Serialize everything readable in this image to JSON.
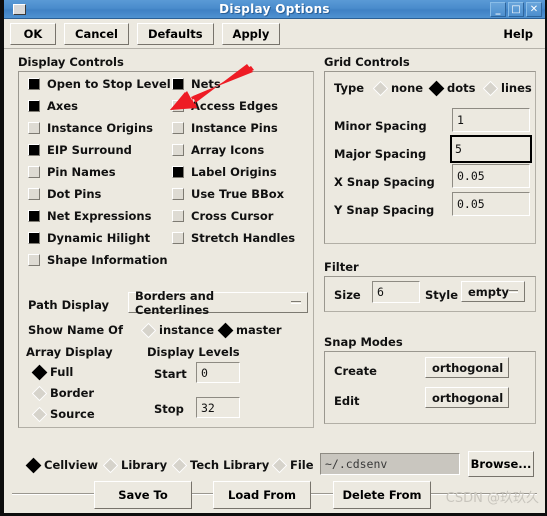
{
  "window": {
    "title": "Display Options",
    "icon": "window-menu-icon",
    "buttons": [
      {
        "name": "minimize",
        "glyph": "_"
      },
      {
        "name": "maximize",
        "glyph": "□"
      },
      {
        "name": "close",
        "glyph": "✕"
      }
    ]
  },
  "toolbar": {
    "ok": "OK",
    "cancel": "Cancel",
    "defaults": "Defaults",
    "apply": "Apply",
    "help": "Help"
  },
  "display_controls": {
    "title": "Display Controls",
    "left_column": [
      {
        "label": "Open to Stop Level",
        "checked": true
      },
      {
        "label": "Axes",
        "checked": true
      },
      {
        "label": "Instance Origins",
        "checked": false
      },
      {
        "label": "EIP Surround",
        "checked": true
      },
      {
        "label": "Pin Names",
        "checked": false
      },
      {
        "label": "Dot Pins",
        "checked": false
      },
      {
        "label": "Net Expressions",
        "checked": true
      },
      {
        "label": "Dynamic Hilight",
        "checked": true
      },
      {
        "label": "Shape Information",
        "checked": false
      }
    ],
    "right_column": [
      {
        "label": "Nets",
        "checked": true
      },
      {
        "label": "Access Edges",
        "checked": false
      },
      {
        "label": "Instance Pins",
        "checked": false
      },
      {
        "label": "Array Icons",
        "checked": false
      },
      {
        "label": "Label Origins",
        "checked": true
      },
      {
        "label": "Use True BBox",
        "checked": false
      },
      {
        "label": "Cross Cursor",
        "checked": false
      },
      {
        "label": "Stretch Handles",
        "checked": false
      }
    ],
    "path_display": {
      "label": "Path Display",
      "value": "Borders and Centerlines"
    },
    "show_name_of": {
      "label": "Show Name Of",
      "options": [
        {
          "label": "instance",
          "selected": false
        },
        {
          "label": "master",
          "selected": true
        }
      ]
    },
    "array_display": {
      "label": "Array Display",
      "options": [
        {
          "label": "Full",
          "selected": true
        },
        {
          "label": "Border",
          "selected": false
        },
        {
          "label": "Source",
          "selected": false
        }
      ]
    },
    "display_levels": {
      "label": "Display Levels",
      "start_label": "Start",
      "start_value": "0",
      "stop_label": "Stop",
      "stop_value": "32"
    }
  },
  "grid_controls": {
    "title": "Grid Controls",
    "type_label": "Type",
    "type_options": [
      {
        "label": "none",
        "selected": false
      },
      {
        "label": "dots",
        "selected": true
      },
      {
        "label": "lines",
        "selected": false
      }
    ],
    "fields": [
      {
        "label": "Minor Spacing",
        "value": "1",
        "focused": false
      },
      {
        "label": "Major Spacing",
        "value": "5",
        "focused": true
      },
      {
        "label": "X Snap Spacing",
        "value": "0.05",
        "focused": false
      },
      {
        "label": "Y Snap Spacing",
        "value": "0.05",
        "focused": false
      }
    ]
  },
  "filter": {
    "title": "Filter",
    "size_label": "Size",
    "size_value": "6",
    "style_label": "Style",
    "style_value": "empty"
  },
  "snap_modes": {
    "title": "Snap Modes",
    "create_label": "Create",
    "create_value": "orthogonal",
    "edit_label": "Edit",
    "edit_value": "orthogonal"
  },
  "bottom": {
    "scope_options": [
      {
        "label": "Cellview",
        "selected": true
      },
      {
        "label": "Library",
        "selected": false
      },
      {
        "label": "Tech Library",
        "selected": false
      },
      {
        "label": "File",
        "selected": false
      }
    ],
    "file_value": "~/.cdsenv",
    "browse": "Browse...",
    "save_to": "Save To",
    "load_from": "Load From",
    "delete_from": "Delete From"
  },
  "watermark": "CSDN @玖玖久",
  "colors": {
    "titlebar": "#4a8ccc",
    "face": "#ece9e0",
    "arrow": "#ee1c25"
  }
}
